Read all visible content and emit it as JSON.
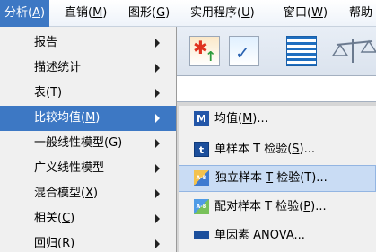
{
  "menubar": {
    "items": [
      {
        "label": "分析(",
        "key": "A",
        "end": ")"
      },
      {
        "label": "直销(",
        "key": "M",
        "end": ")"
      },
      {
        "label": "图形(",
        "key": "G",
        "end": ")"
      },
      {
        "label": "实用程序(",
        "key": "U",
        "end": ")"
      },
      {
        "label": "窗口(",
        "key": "W",
        "end": ")"
      },
      {
        "label": "帮助",
        "key": "",
        "end": ""
      }
    ]
  },
  "analyze_menu": {
    "items": [
      {
        "label": "报告",
        "key": "",
        "end": ""
      },
      {
        "label": "描述统计",
        "key": "",
        "end": ""
      },
      {
        "label": "表(T)",
        "key": "",
        "end": ""
      },
      {
        "label": "比较均值(",
        "key": "M",
        "end": ")"
      },
      {
        "label": "一般线性模型(G)",
        "key": "",
        "end": ""
      },
      {
        "label": "广义线性模型",
        "key": "",
        "end": ""
      },
      {
        "label": "混合模型(",
        "key": "X",
        "end": ")"
      },
      {
        "label": "相关(",
        "key": "C",
        "end": ")"
      },
      {
        "label": "回归(R)",
        "key": "",
        "end": ""
      }
    ]
  },
  "compare_means_menu": {
    "items": [
      {
        "label": "均值(",
        "key": "M",
        "end": ")...",
        "icon": "means-icon",
        "glyph": "M"
      },
      {
        "label": "单样本 T 检验(",
        "key": "S",
        "end": ")...",
        "icon": "one-sample-t-icon",
        "glyph": "t"
      },
      {
        "label": "独立样本 ",
        "key": "T",
        "end": " 检验(T)...",
        "icon": "independent-samples-icon",
        "glyph": "A-B"
      },
      {
        "label": "配对样本 T 检验(",
        "key": "P",
        "end": ")...",
        "icon": "paired-samples-icon",
        "glyph": "A-B"
      },
      {
        "label": "单因素 ANOVA...",
        "key": "",
        "end": "",
        "icon": "one-way-anova-icon",
        "glyph": ""
      }
    ]
  },
  "colors": {
    "accent": "#3d78c4",
    "hover": "#c9dcf4"
  }
}
